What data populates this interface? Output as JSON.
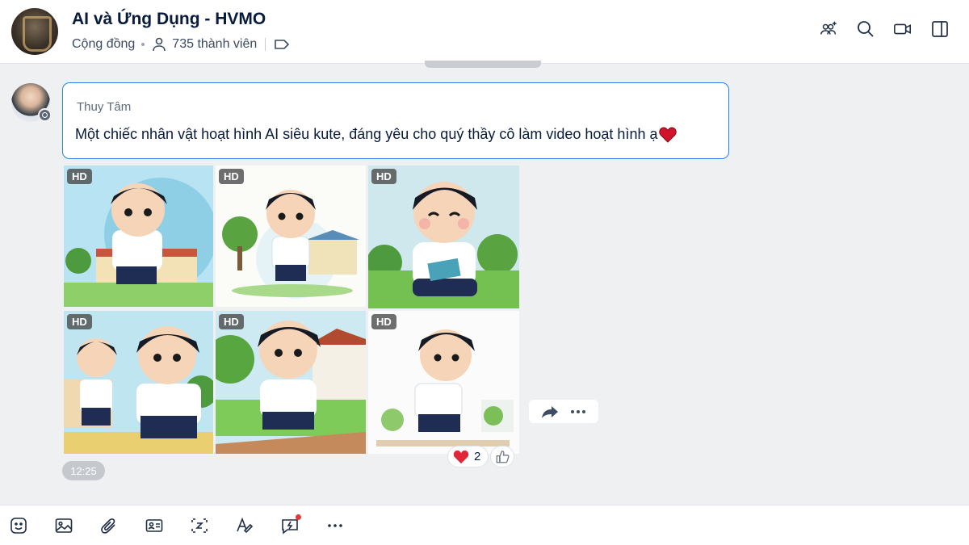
{
  "header": {
    "title": "AI và Ứng Dụng - HVMO",
    "community_label": "Cộng đồng",
    "member_count": "735 thành viên",
    "icons": [
      "add-member-icon",
      "search-icon",
      "video-call-icon",
      "sidebar-toggle-icon"
    ]
  },
  "message": {
    "sender": "Thuy Tâm",
    "text": "Một chiếc nhân vật hoạt hình AI siêu kute, đáng yêu cho quý thầy cô làm video hoạt hình ạ",
    "time": "12:25",
    "image_badge": "HD",
    "reaction_count": "2"
  },
  "images": [
    {
      "badge": "HD",
      "icon": "cartoon-boy-running-image"
    },
    {
      "badge": "HD",
      "icon": "cartoon-boy-walking-image"
    },
    {
      "badge": "HD",
      "icon": "cartoon-boy-reading-image"
    },
    {
      "badge": "HD",
      "icon": "cartoon-two-boys-image"
    },
    {
      "badge": "HD",
      "icon": "cartoon-boy-backpack-image"
    },
    {
      "badge": "HD",
      "icon": "cartoon-boy-jogging-image"
    }
  ],
  "toolbar": {
    "icons": [
      "sticker-icon",
      "image-icon",
      "attachment-icon",
      "contact-card-icon",
      "screenshot-icon",
      "text-format-icon",
      "quick-message-icon",
      "more-icon"
    ]
  },
  "colors": {
    "accent": "#2d7ff0",
    "text_primary": "#081b3a",
    "background": "#eef0f1",
    "reaction_heart": "#e0263a"
  }
}
